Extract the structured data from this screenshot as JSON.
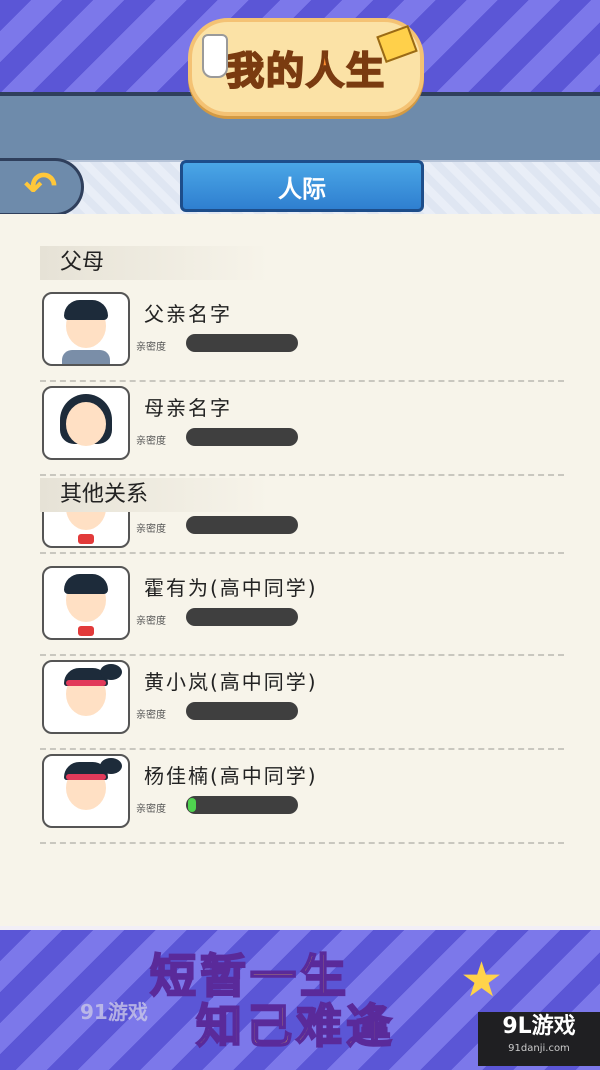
{
  "app": {
    "title": "我的人生"
  },
  "header": {
    "tab_title": "人际",
    "back_icon": "back-arrow-icon"
  },
  "sections": [
    {
      "label": "父母"
    },
    {
      "label": "其他关系"
    }
  ],
  "affinity_label": "亲密度",
  "parents": [
    {
      "name": "父亲名字",
      "affinity": 0.0,
      "avatar": "father"
    },
    {
      "name": "母亲名字",
      "affinity": 0.0,
      "avatar": "mother"
    }
  ],
  "others": [
    {
      "name": "",
      "affinity": 0.0,
      "avatar": "boy"
    },
    {
      "name": "霍有为(高中同学)",
      "affinity": 0.0,
      "avatar": "boy"
    },
    {
      "name": "黄小岚(高中同学)",
      "affinity": 0.0,
      "avatar": "girl"
    },
    {
      "name": "杨佳楠(高中同学)",
      "affinity": 0.04,
      "avatar": "girl"
    }
  ],
  "banner": {
    "slogan_line1": "短暂一生",
    "slogan_line2": "知己难逢",
    "watermark_left": "91游戏",
    "watermark_right": "9L游戏",
    "watermark_url": "91danji.com"
  },
  "colors": {
    "band": "#5b56d6",
    "accent_tab": "#2f7fd0",
    "bar_bg": "#3f3f3f",
    "bar_fill": "#4fd24f"
  }
}
